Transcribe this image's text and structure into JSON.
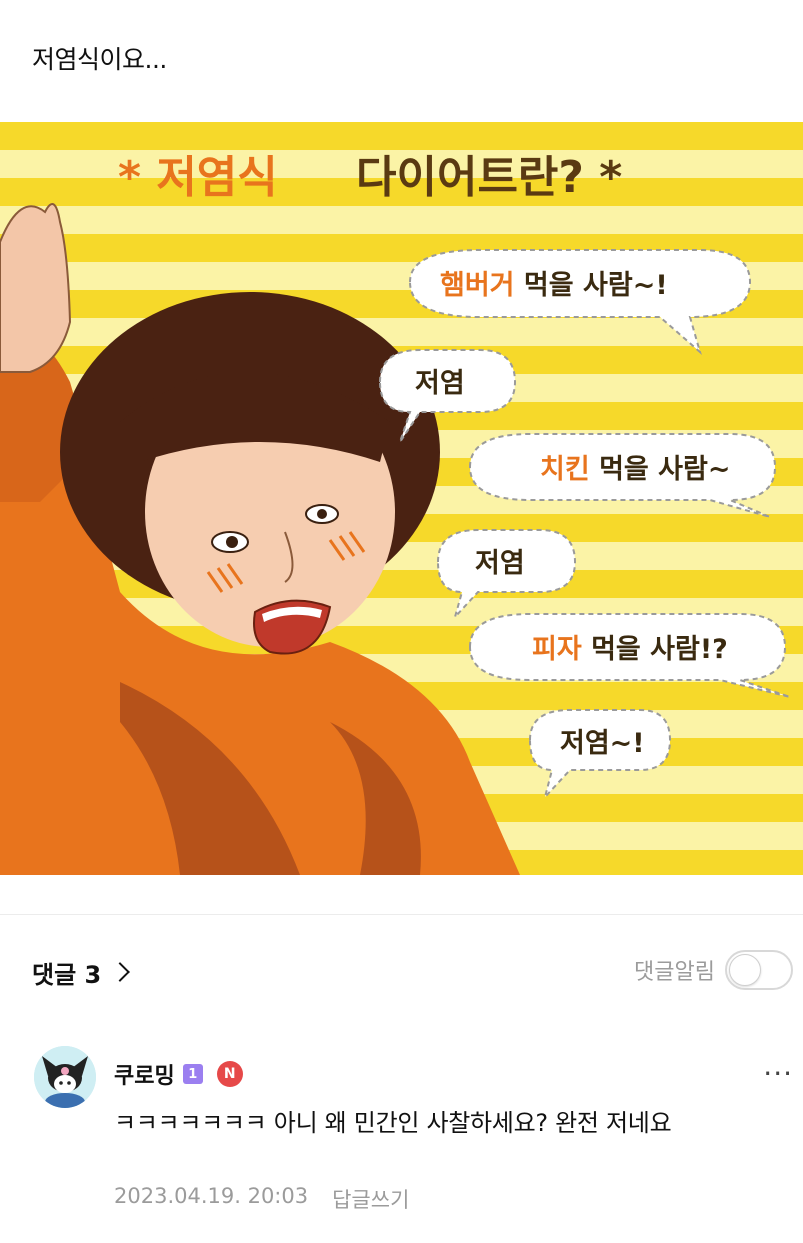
{
  "post": {
    "title": "저염식이요..."
  },
  "meme": {
    "headline_left": "* 저염식",
    "headline_right": "다이어트란? *",
    "bubbles": [
      {
        "highlight": "햄버거",
        "rest": " 먹을 사람~!"
      },
      {
        "highlight": "",
        "rest": "저염"
      },
      {
        "highlight": "치킨",
        "rest": " 먹을 사람~"
      },
      {
        "highlight": "",
        "rest": "저염"
      },
      {
        "highlight": "피자",
        "rest": " 먹을 사람!?"
      },
      {
        "highlight": "",
        "rest": "저염~!"
      }
    ],
    "colors": {
      "stripe_yellow": "#f6d92a",
      "stripe_light": "#fbf3a6",
      "sweater": "#e8741d",
      "hair": "#4a2212"
    }
  },
  "comments_section": {
    "label": "댓글 3",
    "notify_label": "댓글알림",
    "notify_on": false
  },
  "comment": {
    "author": "쿠로밍",
    "level_badge": "1",
    "new_badge": "N",
    "more_icon": "···",
    "text": "ㅋㅋㅋㅋㅋㅋㅋ 아니 왜 민간인 사찰하세요? 완전 저네요",
    "timestamp": "2023.04.19. 20:03",
    "reply_label": "답글쓰기"
  }
}
